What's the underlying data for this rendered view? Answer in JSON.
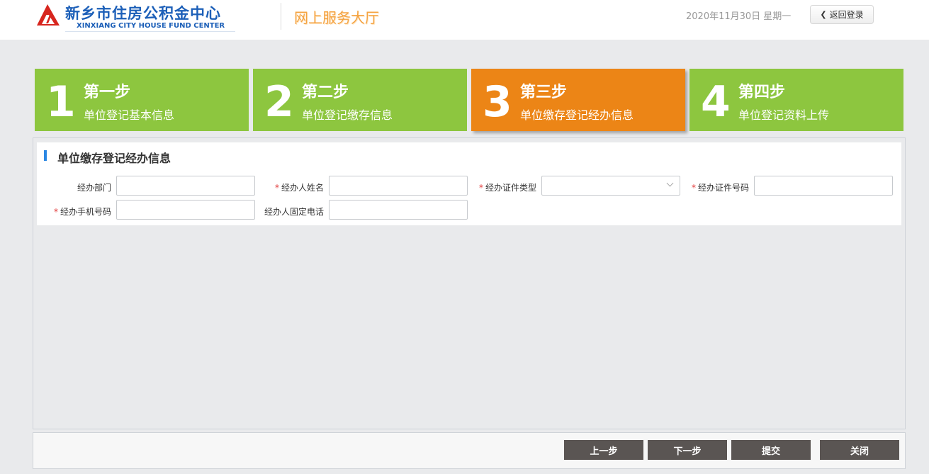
{
  "header": {
    "org_name": "新乡市住房公积金中心",
    "org_name_en": "XINXIANG CITY HOUSE FUND CENTER",
    "hall_title": "网上服务大厅",
    "date": "2020年11月30日 星期一",
    "back_label": "返回登录",
    "logo_icon": "logo-emblem",
    "back_icon": "chevron-left-icon"
  },
  "steps": [
    {
      "num": "1",
      "title": "第一步",
      "desc": "单位登记基本信息",
      "active": false
    },
    {
      "num": "2",
      "title": "第二步",
      "desc": "单位登记缴存信息",
      "active": false
    },
    {
      "num": "3",
      "title": "第三步",
      "desc": "单位缴存登记经办信息",
      "active": true
    },
    {
      "num": "4",
      "title": "第四步",
      "desc": "单位登记资料上传",
      "active": false
    }
  ],
  "colors": {
    "step_done": "#8dc63f",
    "step_active": "#ec8516",
    "accent_blue": "#2b87e3",
    "required": "#e23c3c",
    "button_dark": "#5a5553"
  },
  "form": {
    "section_title": "单位缴存登记经办信息",
    "fields": {
      "dept": {
        "label": "经办部门",
        "value": "",
        "required": false
      },
      "name": {
        "label": "经办人姓名",
        "value": "",
        "required": true
      },
      "id_type": {
        "label": "经办证件类型",
        "value": "",
        "required": true
      },
      "id_number": {
        "label": "经办证件号码",
        "value": "",
        "required": true
      },
      "mobile": {
        "label": "经办手机号码",
        "value": "",
        "required": true
      },
      "phone": {
        "label": "经办人固定电话",
        "value": "",
        "required": false
      }
    }
  },
  "footer": {
    "prev_label": "上一步",
    "next_label": "下一步",
    "submit_label": "提交",
    "close_label": "关闭"
  }
}
